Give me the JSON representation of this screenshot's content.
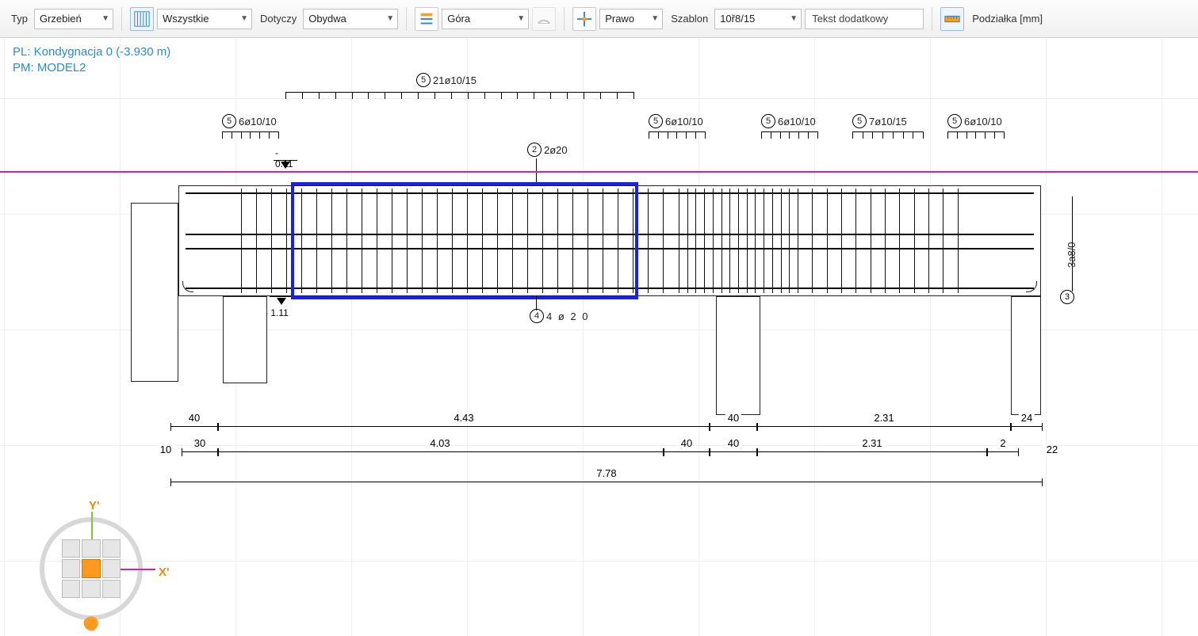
{
  "toolbar": {
    "typ_label": "Typ",
    "typ_value": "Grzebień",
    "wszystkie": "Wszystkie",
    "dotyczy_label": "Dotyczy",
    "dotyczy_value": "Obydwa",
    "pos_value": "Góra",
    "side_value": "Prawo",
    "szablon_label": "Szablon",
    "szablon_value": "10ř8/15",
    "extratext_label": "Tekst dodatkowy",
    "scale_label": "Podziałka [mm]"
  },
  "header": {
    "line1": "PL: Kondygnacja 0 (-3.930 m)",
    "line2": "PM: MODEL2"
  },
  "rebars": {
    "top_long": {
      "n": "5",
      "txt": "21ø10/15"
    },
    "r1": {
      "n": "5",
      "txt": "6ø10/10"
    },
    "r2": {
      "n": "5",
      "txt": "6ø10/10"
    },
    "r3": {
      "n": "5",
      "txt": "6ø10/10"
    },
    "r4": {
      "n": "5",
      "txt": "7ø10/15"
    },
    "r5": {
      "n": "5",
      "txt": "6ø10/10"
    },
    "mid": {
      "n": "2",
      "txt": "2ø20"
    },
    "bot": {
      "n": "4",
      "txt": "4 ø 2 0"
    },
    "side": {
      "n": "3",
      "txt": "3a8/0"
    }
  },
  "levels": {
    "top": "- 0.11",
    "bot": "- 1.11"
  },
  "dims": {
    "row1": [
      "40",
      "4.43",
      "40",
      "2.31",
      "24"
    ],
    "row2_pre": "10",
    "row2": [
      "30",
      "4.03",
      "40",
      "40",
      "2.31",
      "2"
    ],
    "row2_suf": "22",
    "total": "7.78"
  },
  "nav": {
    "y": "Y'",
    "x": "X'"
  }
}
